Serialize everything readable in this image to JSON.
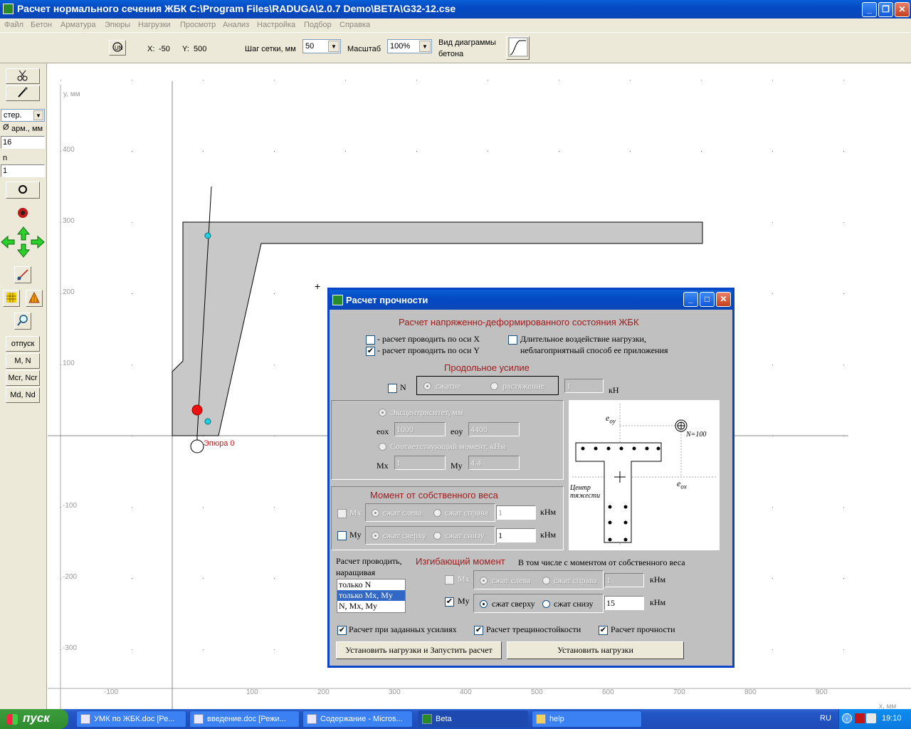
{
  "window": {
    "title": "Расчет нормального сечения ЖБК   C:\\Program Files\\RADUGA\\2.0.7 Demo\\BETA\\G32-12.cse"
  },
  "menu": [
    "Файл",
    "Бетон",
    "Арматура",
    "Эпюры",
    "Нагрузки",
    "Просмотр",
    "Анализ",
    "Настройка",
    "Подбор",
    "Справка"
  ],
  "toolbar": {
    "x_label": "X:",
    "x_value": "-50",
    "y_label": "Y:",
    "y_value": "500",
    "grid_label": "Шаг сетки, мм",
    "grid_value": "50",
    "scale_label": "Масштаб",
    "scale_value": "100%",
    "diagram_label_1": "Вид диаграммы",
    "diagram_label_2": "бетона"
  },
  "left_panel": {
    "rebar_type": "стер.",
    "diameter_label": "арм., мм",
    "diameter_symbol": "Ø",
    "diameter_value": "16",
    "n_label": "n",
    "n_value": "1",
    "buttons": [
      "отпуск",
      "M, N",
      "Mcr, Ncr",
      "Md, Nd"
    ]
  },
  "canvas": {
    "y_axis_label": "y, мм",
    "x_axis_label": "x, мм",
    "y_ticks": [
      "400",
      "300",
      "200",
      "100",
      "-100",
      "-200",
      "-300"
    ],
    "x_ticks": [
      "-100",
      "100",
      "200",
      "300",
      "400",
      "500",
      "600",
      "700",
      "800",
      "900"
    ],
    "epure_label": "Эпюра 0",
    "cursor": "+"
  },
  "dialog": {
    "title": "Расчет прочности",
    "heading": "Расчет напряженно-деформированного состояния ЖБК",
    "calc_x_label": "- расчет проводить по оси X",
    "calc_x_checked": false,
    "calc_y_label": "- расчет проводить по оси Y",
    "calc_y_checked": true,
    "long_term_label_1": "Длительное воздействие нагрузки,",
    "long_term_label_2": "неблагоприятный способ ее приложения",
    "axial": {
      "heading": "Продольное усилие",
      "n_label": "N",
      "compression": "сжатие",
      "tension": "растяжение",
      "value": "1",
      "unit": "кН"
    },
    "eccentricity": {
      "ecc_label": "Эксцентриситет, мм",
      "eox_label": "eox",
      "eox_value": "1000",
      "eoy_label": "eoy",
      "eoy_value": "4400",
      "moment_label": "Соответствующий момент, кНм",
      "mx_label": "Mx",
      "mx_value": "1",
      "my_label": "My",
      "my_value": "4.4"
    },
    "sketch": {
      "eoy": "e",
      "eoy_sub": "oy",
      "eox": "e",
      "eox_sub": "ox",
      "n_label": "N=100",
      "center_1": "Центр",
      "center_2": "тяжести"
    },
    "self_weight": {
      "heading": "Момент от собственного веса",
      "mx_label": "Mx",
      "my_label": "My",
      "left": "сжат слева",
      "right": "сжат справа",
      "top": "сжат сверху",
      "bottom": "сжат снизу",
      "mx_value": "1",
      "my_value": "1",
      "unit": "кНм"
    },
    "calc_mode": {
      "label_1": "Расчет проводить,",
      "label_2": "наращивая",
      "options": [
        "только N",
        "только Mx, My",
        "N, Mx, My"
      ],
      "selected": "только Mx, My"
    },
    "bending": {
      "heading": "Изгибающий момент",
      "incl_label": "В том числе с моментом от  собственного веса",
      "mx_label": "Mx",
      "my_label": "My",
      "left": "сжат слева",
      "right": "сжат справа",
      "top": "сжат сверху",
      "bottom": "сжат снизу",
      "mx_value": "1",
      "my_value": "15",
      "unit": "кНм"
    },
    "checks": {
      "given_forces": "Расчет при заданных усилиях",
      "crack": "Расчет трещиностойкости",
      "strength": "Расчет прочности"
    },
    "buttons": {
      "run": "Установить нагрузки и Запустить расчет",
      "set": "Установить нагрузки"
    }
  },
  "taskbar": {
    "start": "пуск",
    "tasks": [
      "УМК по ЖБК.doc [Ре...",
      "введение.doc [Режи...",
      "Содержание - Micros...",
      "Beta",
      "help"
    ],
    "lang": "RU",
    "time": "19:10"
  }
}
